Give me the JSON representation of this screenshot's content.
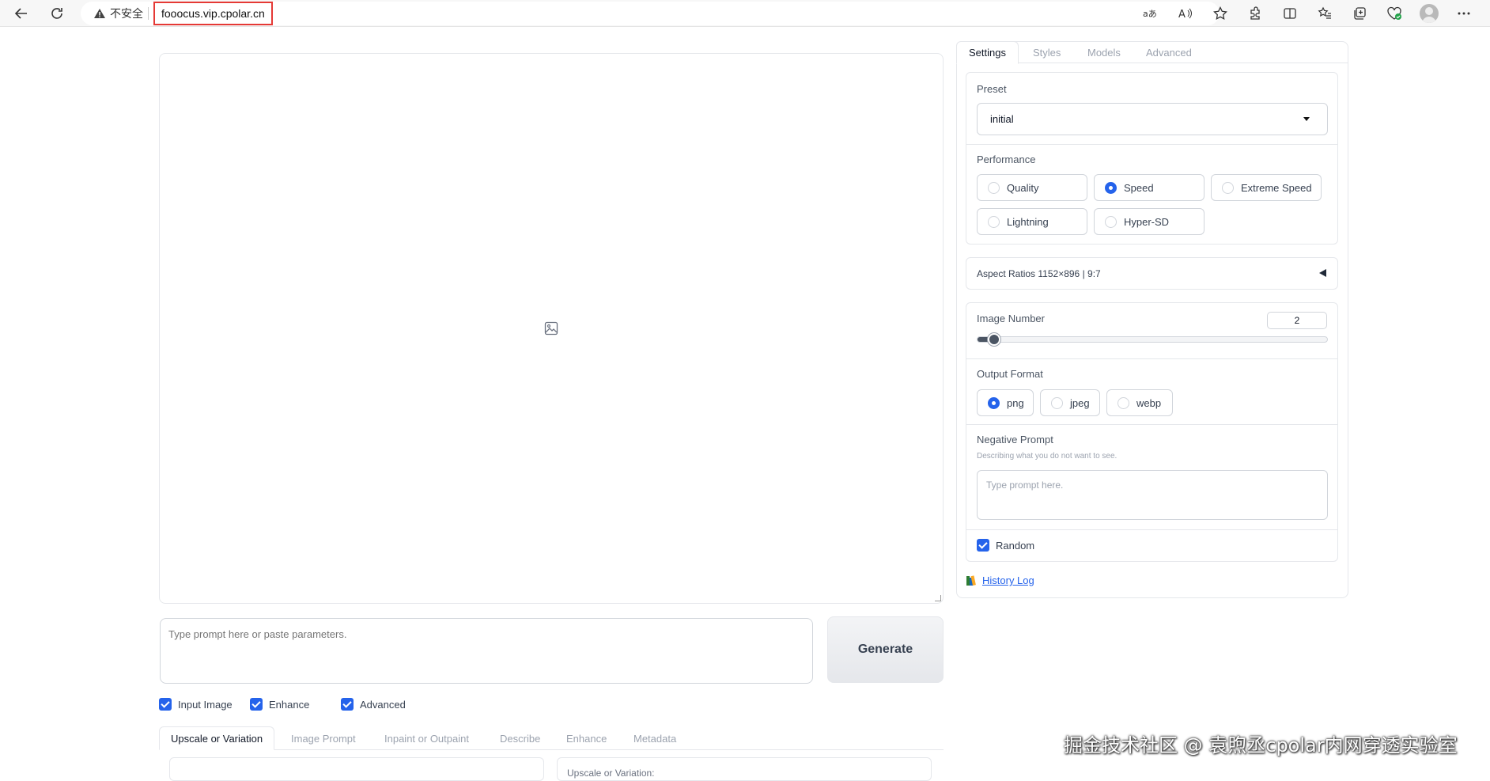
{
  "browser": {
    "security_label": "不安全",
    "url": "fooocus.vip.cpolar.cn"
  },
  "main": {
    "prompt_placeholder": "Type prompt here or paste parameters.",
    "generate_label": "Generate",
    "checkboxes": [
      {
        "label": "Input Image",
        "checked": true
      },
      {
        "label": "Enhance",
        "checked": true
      },
      {
        "label": "Advanced",
        "checked": true
      }
    ],
    "tabs": [
      "Upscale or Variation",
      "Image Prompt",
      "Inpaint or Outpaint",
      "Describe",
      "Enhance",
      "Metadata"
    ],
    "active_tab": "Upscale or Variation",
    "subpanel_label": "Upscale or Variation:"
  },
  "settings": {
    "tabs": [
      "Settings",
      "Styles",
      "Models",
      "Advanced"
    ],
    "active_tab": "Settings",
    "preset": {
      "label": "Preset",
      "value": "initial"
    },
    "performance": {
      "label": "Performance",
      "options": [
        "Quality",
        "Speed",
        "Extreme Speed",
        "Lightning",
        "Hyper-SD"
      ],
      "selected": "Speed"
    },
    "aspect_ratios": {
      "label": "Aspect Ratios",
      "value": "1152×896",
      "ratio": "9:7"
    },
    "image_number": {
      "label": "Image Number",
      "value": "2",
      "fraction": 0.03
    },
    "output_format": {
      "label": "Output Format",
      "options": [
        "png",
        "jpeg",
        "webp"
      ],
      "selected": "png"
    },
    "negative_prompt": {
      "label": "Negative Prompt",
      "info": "Describing what you do not want to see.",
      "placeholder": "Type prompt here."
    },
    "random": {
      "label": "Random",
      "checked": true
    },
    "history_log": "History Log"
  },
  "watermark": "掘金技术社区 @ 袁煦丞cpolar内网穿透实验室",
  "colors": {
    "accent": "#2563eb",
    "url_highlight": "#e53935"
  }
}
